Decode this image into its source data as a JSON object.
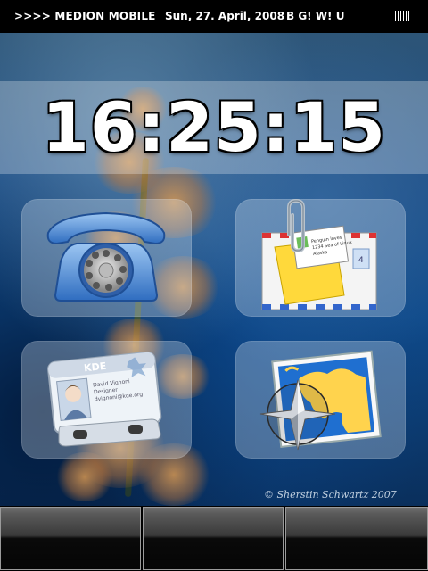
{
  "status_bar": {
    "operator": ">>>> MEDION MOBILE",
    "date": "Sun, 27. April, 2008",
    "indicators": "B G! W! U",
    "signal_icon": "signal-bars-icon"
  },
  "clock": {
    "time": "16:25:15"
  },
  "tiles": [
    {
      "id": "phone",
      "icon": "telephone-icon"
    },
    {
      "id": "mail",
      "icon": "mail-icon"
    },
    {
      "id": "contacts",
      "icon": "contact-card-icon"
    },
    {
      "id": "map",
      "icon": "map-compass-icon"
    }
  ],
  "contact_card": {
    "brand": "KDE",
    "name": "David Vignoni",
    "title": "Designer",
    "email": "dvignoni@kde.org"
  },
  "mail_note": {
    "line1": "Penguin loves",
    "line2": "1234 Sea of Linux",
    "line3": "Alaska"
  },
  "wallpaper": {
    "credit": "© Sherstin Schwartz 2007"
  },
  "soft_keys": {
    "left": "",
    "middle": "",
    "right": ""
  },
  "colors": {
    "status_bar": "#000000",
    "tile_glass": "rgba(230,238,248,0.30)",
    "clock_text": "#ffffff"
  }
}
